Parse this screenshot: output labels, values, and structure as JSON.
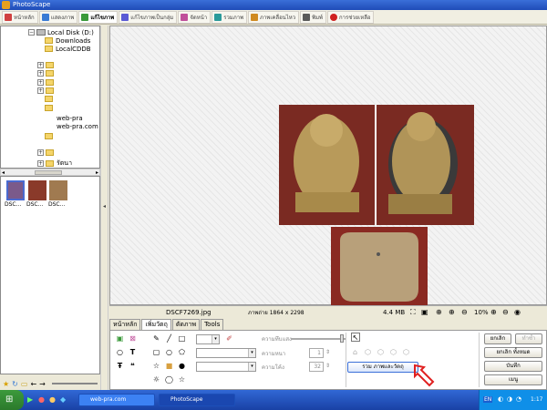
{
  "window": {
    "title": "PhotoScape"
  },
  "tabs": [
    {
      "label": "หน้าหลัก",
      "color": "#d04040"
    },
    {
      "label": "แสดงภาพ",
      "color": "#3a7bd5"
    },
    {
      "label": "แก้ไขภาพ",
      "color": "#3a9a3a",
      "active": true
    },
    {
      "label": "แก้ไขภาพเป็นกลุ่ม",
      "color": "#5a5ad5"
    },
    {
      "label": "จัดหน้า",
      "color": "#c04f9a"
    },
    {
      "label": "รวมภาพ",
      "color": "#2a9a9a"
    },
    {
      "label": "ภาพเคลื่อนไหว",
      "color": "#d08a20"
    },
    {
      "label": "พิมพ์",
      "color": "#5a5a5a"
    },
    {
      "label": "การช่วยเหลือ",
      "color": "#d02020"
    }
  ],
  "tree": {
    "drive": "Local Disk (D:)",
    "items": [
      "Downloads",
      "LocalCDDB",
      "web-pra",
      "web-pra.com",
      "รัตนา"
    ]
  },
  "thumbnails": [
    "DSC...",
    "DSC...",
    "DSC..."
  ],
  "info": {
    "filename": "DSCF7269.jpg",
    "dimensions": "ภาพถ่าย 1864 x 2298",
    "filesize": "4.4 MB",
    "zoom": "10%"
  },
  "edit_tabs": [
    "หน้าหลัก",
    "เพิ่มวัตถุ",
    "ตัดภาพ",
    "Tools"
  ],
  "object_panel": {
    "transparency_label": "ความทึบแสง",
    "thickness_label": "ความหนา",
    "thickness_value": "1",
    "roundness_label": "ความโค้ง",
    "roundness_value": "32",
    "merge_button": "รวม ภาพและวัตถุ"
  },
  "right_buttons": {
    "undo": "ยกเลิก",
    "redo": "ทำซ้ำ",
    "undo_all": "ยกเลิก ทั้งหมด",
    "save": "บันทึก",
    "menu": "เมนู"
  },
  "taskbar": {
    "task1": "web-pra.com",
    "task2": "PhotoScape",
    "lang": "EN",
    "clock": "1:17"
  }
}
